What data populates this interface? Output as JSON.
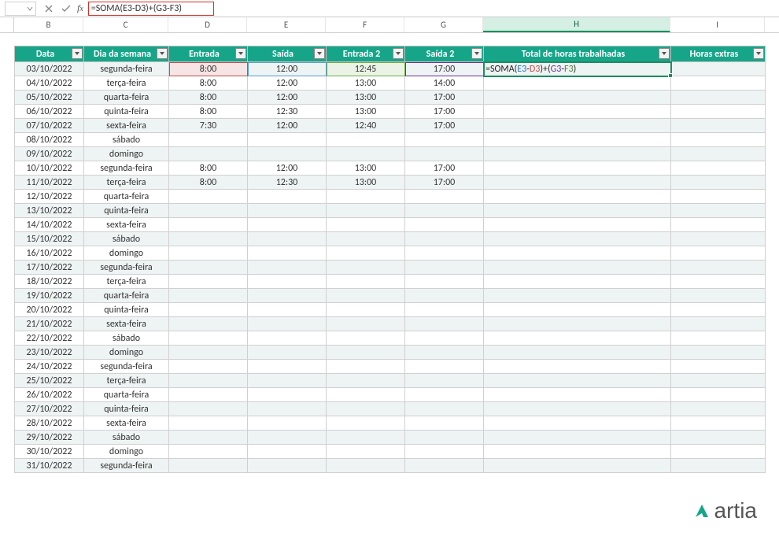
{
  "formula_bar": {
    "formula_text": "=SOMA(E3-D3)+(G3-F3)"
  },
  "columns": [
    "B",
    "C",
    "D",
    "E",
    "F",
    "G",
    "H",
    "I"
  ],
  "selected_column": "H",
  "headers": {
    "B": "Data",
    "C": "Dia da semana",
    "D": "Entrada",
    "E": "Saída",
    "F": "Entrada 2",
    "G": "Saída 2",
    "H": "Total de horas trabalhadas",
    "I": "Horas extras"
  },
  "active_cell_formula": {
    "prefix": "=SOMA(",
    "E3": "E3",
    "minus1": "-",
    "D3": "D3",
    "mid": ")+(",
    "G3": "G3",
    "minus2": "-",
    "F3": "F3",
    "suffix": ")"
  },
  "rows": [
    {
      "data": "03/10/2022",
      "dia": "segunda-feira",
      "entrada": "8:00",
      "saida": "12:00",
      "entrada2": "12:45",
      "saida2": "17:00",
      "total": "",
      "extras": ""
    },
    {
      "data": "04/10/2022",
      "dia": "terça-feira",
      "entrada": "8:00",
      "saida": "12:00",
      "entrada2": "13:00",
      "saida2": "14:00",
      "total": "",
      "extras": ""
    },
    {
      "data": "05/10/2022",
      "dia": "quarta-feira",
      "entrada": "8:00",
      "saida": "12:00",
      "entrada2": "13:00",
      "saida2": "17:00",
      "total": "",
      "extras": ""
    },
    {
      "data": "06/10/2022",
      "dia": "quinta-feira",
      "entrada": "8:00",
      "saida": "12:30",
      "entrada2": "13:00",
      "saida2": "17:00",
      "total": "",
      "extras": ""
    },
    {
      "data": "07/10/2022",
      "dia": "sexta-feira",
      "entrada": "7:30",
      "saida": "12:00",
      "entrada2": "12:40",
      "saida2": "17:00",
      "total": "",
      "extras": ""
    },
    {
      "data": "08/10/2022",
      "dia": "sábado",
      "entrada": "",
      "saida": "",
      "entrada2": "",
      "saida2": "",
      "total": "",
      "extras": ""
    },
    {
      "data": "09/10/2022",
      "dia": "domingo",
      "entrada": "",
      "saida": "",
      "entrada2": "",
      "saida2": "",
      "total": "",
      "extras": ""
    },
    {
      "data": "10/10/2022",
      "dia": "segunda-feira",
      "entrada": "8:00",
      "saida": "12:00",
      "entrada2": "13:00",
      "saida2": "17:00",
      "total": "",
      "extras": ""
    },
    {
      "data": "11/10/2022",
      "dia": "terça-feira",
      "entrada": "8:00",
      "saida": "12:30",
      "entrada2": "13:00",
      "saida2": "17:00",
      "total": "",
      "extras": ""
    },
    {
      "data": "12/10/2022",
      "dia": "quarta-feira",
      "entrada": "",
      "saida": "",
      "entrada2": "",
      "saida2": "",
      "total": "",
      "extras": ""
    },
    {
      "data": "13/10/2022",
      "dia": "quinta-feira",
      "entrada": "",
      "saida": "",
      "entrada2": "",
      "saida2": "",
      "total": "",
      "extras": ""
    },
    {
      "data": "14/10/2022",
      "dia": "sexta-feira",
      "entrada": "",
      "saida": "",
      "entrada2": "",
      "saida2": "",
      "total": "",
      "extras": ""
    },
    {
      "data": "15/10/2022",
      "dia": "sábado",
      "entrada": "",
      "saida": "",
      "entrada2": "",
      "saida2": "",
      "total": "",
      "extras": ""
    },
    {
      "data": "16/10/2022",
      "dia": "domingo",
      "entrada": "",
      "saida": "",
      "entrada2": "",
      "saida2": "",
      "total": "",
      "extras": ""
    },
    {
      "data": "17/10/2022",
      "dia": "segunda-feira",
      "entrada": "",
      "saida": "",
      "entrada2": "",
      "saida2": "",
      "total": "",
      "extras": ""
    },
    {
      "data": "18/10/2022",
      "dia": "terça-feira",
      "entrada": "",
      "saida": "",
      "entrada2": "",
      "saida2": "",
      "total": "",
      "extras": ""
    },
    {
      "data": "19/10/2022",
      "dia": "quarta-feira",
      "entrada": "",
      "saida": "",
      "entrada2": "",
      "saida2": "",
      "total": "",
      "extras": ""
    },
    {
      "data": "20/10/2022",
      "dia": "quinta-feira",
      "entrada": "",
      "saida": "",
      "entrada2": "",
      "saida2": "",
      "total": "",
      "extras": ""
    },
    {
      "data": "21/10/2022",
      "dia": "sexta-feira",
      "entrada": "",
      "saida": "",
      "entrada2": "",
      "saida2": "",
      "total": "",
      "extras": ""
    },
    {
      "data": "22/10/2022",
      "dia": "sábado",
      "entrada": "",
      "saida": "",
      "entrada2": "",
      "saida2": "",
      "total": "",
      "extras": ""
    },
    {
      "data": "23/10/2022",
      "dia": "domingo",
      "entrada": "",
      "saida": "",
      "entrada2": "",
      "saida2": "",
      "total": "",
      "extras": ""
    },
    {
      "data": "24/10/2022",
      "dia": "segunda-feira",
      "entrada": "",
      "saida": "",
      "entrada2": "",
      "saida2": "",
      "total": "",
      "extras": ""
    },
    {
      "data": "25/10/2022",
      "dia": "terça-feira",
      "entrada": "",
      "saida": "",
      "entrada2": "",
      "saida2": "",
      "total": "",
      "extras": ""
    },
    {
      "data": "26/10/2022",
      "dia": "quarta-feira",
      "entrada": "",
      "saida": "",
      "entrada2": "",
      "saida2": "",
      "total": "",
      "extras": ""
    },
    {
      "data": "27/10/2022",
      "dia": "quinta-feira",
      "entrada": "",
      "saida": "",
      "entrada2": "",
      "saida2": "",
      "total": "",
      "extras": ""
    },
    {
      "data": "28/10/2022",
      "dia": "sexta-feira",
      "entrada": "",
      "saida": "",
      "entrada2": "",
      "saida2": "",
      "total": "",
      "extras": ""
    },
    {
      "data": "29/10/2022",
      "dia": "sábado",
      "entrada": "",
      "saida": "",
      "entrada2": "",
      "saida2": "",
      "total": "",
      "extras": ""
    },
    {
      "data": "30/10/2022",
      "dia": "domingo",
      "entrada": "",
      "saida": "",
      "entrada2": "",
      "saida2": "",
      "total": "",
      "extras": ""
    },
    {
      "data": "31/10/2022",
      "dia": "segunda-feira",
      "entrada": "",
      "saida": "",
      "entrada2": "",
      "saida2": "",
      "total": "",
      "extras": ""
    }
  ],
  "logo_text": "artia"
}
